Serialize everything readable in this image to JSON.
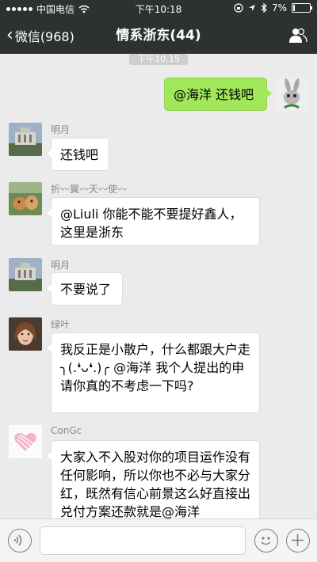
{
  "status_bar": {
    "carrier": "中国电信",
    "time": "下午10:18",
    "battery": "7%"
  },
  "nav": {
    "back_label": "微信(968)",
    "title": "情系浙东(44)"
  },
  "chat": {
    "timestamp": "下午10:15",
    "messages": [
      {
        "sender": "",
        "text": "@海洋 还钱吧",
        "from_me": true
      },
      {
        "sender": "明月",
        "text": "还钱吧"
      },
      {
        "sender": "折〰翼〰天〰使〰",
        "text": "@Liuli 你能不能不要提好鑫人，这里是浙东"
      },
      {
        "sender": "明月",
        "text": "不要说了"
      },
      {
        "sender": "绿叶",
        "text": "我反正是小散户，什么都跟大户走╮(.❛ᴗ❛.)╭ @海洋 我个人提出的申请你真的不考虑一下吗?"
      },
      {
        "sender": "ConGc",
        "text": "大家入不入股对你的项目运作没有任何影响，所以你也不必与大家分红，既然有信心前景这么好直接出兑付方案还款就是@海洋"
      }
    ]
  },
  "icons": {
    "back": "chevron-left-icon",
    "group": "people-icon",
    "voice": "voice-icon",
    "emoji": "emoji-icon",
    "plus": "plus-icon"
  },
  "colors": {
    "nav_bg": "#2e3132",
    "chat_bg": "#ebebeb",
    "my_bubble": "#a0e75a"
  }
}
